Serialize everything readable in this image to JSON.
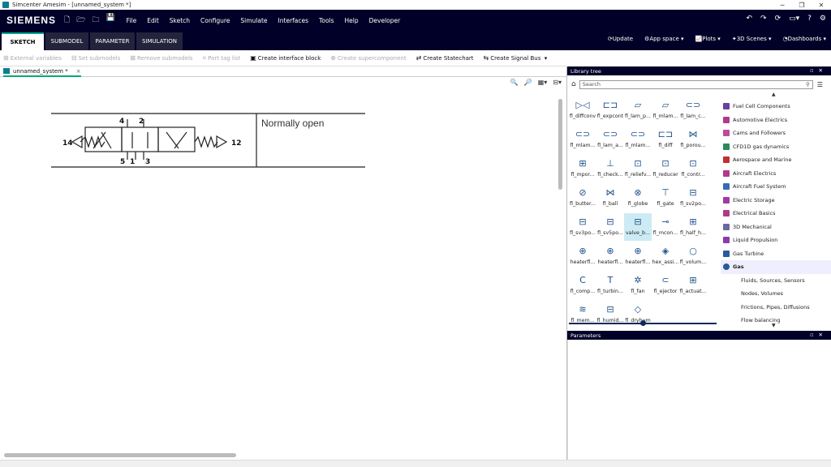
{
  "window": {
    "title": "Simcenter Amesim - [unnamed_system *]",
    "controls": [
      "─",
      "❐",
      "✕"
    ]
  },
  "menubar": {
    "logo": "SIEMENS",
    "quick_icons": [
      "new-file-icon",
      "open-folder-icon",
      "recent-folder-icon",
      "save-icon"
    ],
    "items": [
      "File",
      "Edit",
      "Sketch",
      "Configure",
      "Simulate",
      "Interfaces",
      "Tools",
      "Help",
      "Developer"
    ]
  },
  "tabs": [
    "SKETCH",
    "SUBMODEL",
    "PARAMETER",
    "SIMULATION"
  ],
  "ribbon_right": {
    "update": "Update",
    "app_space": "App space",
    "plots": "Plots",
    "scenes": "3D Scenes",
    "dashboards": "Dashboards"
  },
  "toolbar": {
    "items": [
      {
        "label": "External variables",
        "enabled": false
      },
      {
        "label": "Set submodels",
        "enabled": false
      },
      {
        "label": "Remove submodels",
        "enabled": false
      },
      {
        "label": "Port tag list",
        "enabled": false
      },
      {
        "label": "Create interface block",
        "enabled": true
      },
      {
        "label": "Create supercomponent",
        "enabled": false
      },
      {
        "label": "Create Statechart",
        "enabled": true
      },
      {
        "label": "Create Signal Bus",
        "enabled": true
      }
    ]
  },
  "document_tab": {
    "label": "unnamed_system *",
    "close": "×"
  },
  "diagram": {
    "port_labels": {
      "left": "14",
      "right": "12",
      "top_a": "4",
      "top_b": "2",
      "bottom_a": "5",
      "bottom_b": "1",
      "bottom_c": "3"
    },
    "note": "Normally open"
  },
  "library": {
    "title": "Library tree",
    "search_placeholder": "Search",
    "components": [
      "fl_diffconv",
      "fl_expcont",
      "fl_lam_p...",
      "fl_mlam...",
      "fl_lam_c...",
      "fl_mlam...",
      "fl_lam_a...",
      "fl_mlam...",
      "fl_diff",
      "fl_porou...",
      "fl_mpor...",
      "fl_check...",
      "fl_reliefv...",
      "fl_reducer",
      "fl_contr...",
      "fl_butter...",
      "fl_ball",
      "fl_globe",
      "fl_gate",
      "fl_sv2po...",
      "fl_sv3po...",
      "fl_sv5po...",
      "valve_b...",
      "fl_mcon...",
      "fl_half_h...",
      "heaterfl...",
      "heaterfl...",
      "heaterfl...",
      "hex_assi...",
      "fl_volum...",
      "fl_comp...",
      "fl_turbin...",
      "fl_fan",
      "fl_ejector",
      "fl_actuat...",
      "fl_mem...",
      "fl_humid...",
      "fl_dryhum"
    ],
    "selected_component": "valve_b...",
    "slider_value": 0.5,
    "categories": [
      {
        "label": "Fuel Cell Components",
        "icon": "fuel-cell-icon",
        "color": "#6a3fa0"
      },
      {
        "label": "Automotive Electrics",
        "icon": "auto-electrics-icon",
        "color": "#b03a8a"
      },
      {
        "label": "Cams and Followers",
        "icon": "cam-icon",
        "color": "#c04a9a"
      },
      {
        "label": "CFD1D gas dynamics",
        "icon": "cfd-icon",
        "color": "#2a8a5a"
      },
      {
        "label": "Aerospace and Marine",
        "icon": "aero-icon",
        "color": "#c03030"
      },
      {
        "label": "Aircraft Electrics",
        "icon": "aircraft-electric-icon",
        "color": "#b03a8a"
      },
      {
        "label": "Aircraft Fuel System",
        "icon": "fuel-system-icon",
        "color": "#3a6ab0"
      },
      {
        "label": "Electric Storage",
        "icon": "battery-icon",
        "color": "#a03aa0"
      },
      {
        "label": "Electrical Basics",
        "icon": "electrical-icon",
        "color": "#b03a8a"
      },
      {
        "label": "3D Mechanical",
        "icon": "mechanical-3d-icon",
        "color": "#6a6aa0"
      },
      {
        "label": "Liquid Propulsion",
        "icon": "propulsion-icon",
        "color": "#8a3ab0"
      },
      {
        "label": "Gas Turbine",
        "icon": "turbine-icon",
        "color": "#2a5a9a"
      },
      {
        "label": "Gas",
        "icon": "gas-icon",
        "color": "#2a5a9a",
        "selected": true
      },
      {
        "label": "Fluids, Sources, Sensors",
        "sub": true
      },
      {
        "label": "Nodes, Volumes",
        "sub": true
      },
      {
        "label": "Frictions, Pipes, Diffusions",
        "sub": true
      },
      {
        "label": "Flow balancing",
        "sub": true
      }
    ]
  },
  "parameters": {
    "title": "Parameters"
  }
}
